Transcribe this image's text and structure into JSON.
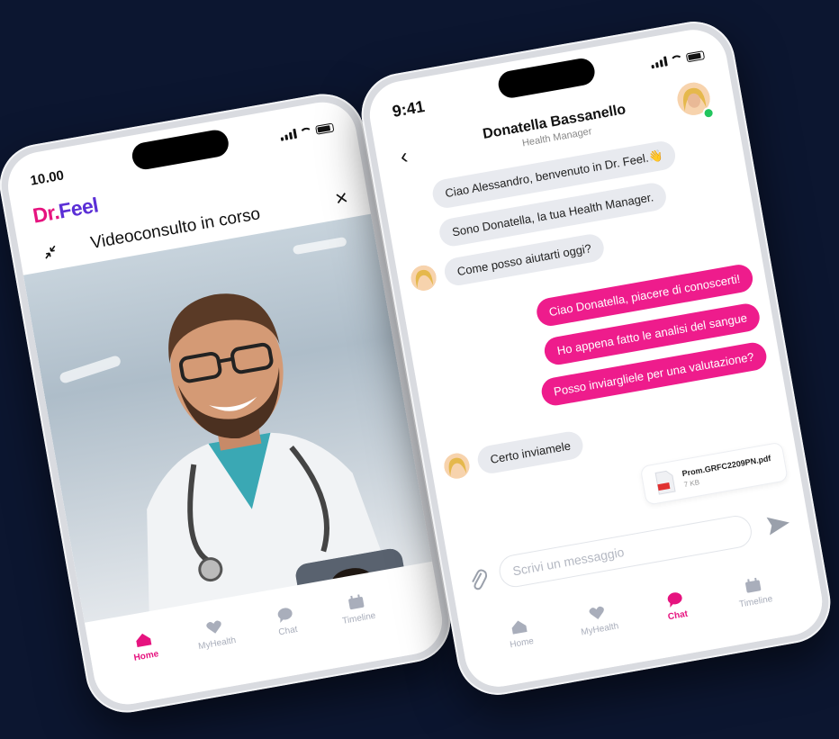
{
  "colors": {
    "background": "#0c1630",
    "brand_pink": "#e6137f",
    "brand_purple": "#5b2fd6",
    "online": "#22c55e"
  },
  "left_phone": {
    "status": {
      "time": "10.00"
    },
    "logo": {
      "part1": "Dr.",
      "part2": "Feel"
    },
    "title": "Videoconsulto in corso",
    "close_icon": "×",
    "tabs": [
      {
        "label": "Home",
        "icon": "home-icon",
        "active": true
      },
      {
        "label": "MyHealth",
        "icon": "heart-icon",
        "active": false
      },
      {
        "label": "Chat",
        "icon": "chat-icon",
        "active": false
      },
      {
        "label": "Timeline",
        "icon": "calendar-icon",
        "active": false
      }
    ]
  },
  "right_phone": {
    "status": {
      "time": "9:41"
    },
    "contact": {
      "name": "Donatella Bassanello",
      "role": "Health Manager",
      "back_icon": "‹"
    },
    "messages": [
      {
        "side": "in",
        "text": "Ciao Alessandro, benvenuto in Dr. Feel.👋"
      },
      {
        "side": "in",
        "text": "Sono Donatella, la tua Health Manager."
      },
      {
        "side": "in",
        "text": "Come posso aiutarti oggi?"
      },
      {
        "side": "out",
        "text": "Ciao Donatella, piacere di conoscerti!"
      },
      {
        "side": "out",
        "text": "Ho appena fatto le analisi del sangue"
      },
      {
        "side": "out",
        "text": "Posso inviargliele per una valutazione?"
      },
      {
        "side": "in",
        "text": "Certo inviamele"
      }
    ],
    "attachment": {
      "name": "Prom.GRFC2209PN.pdf",
      "size": "7 KB"
    },
    "composer": {
      "placeholder": "Scrivi un messaggio"
    },
    "tabs": [
      {
        "label": "Home",
        "icon": "home-icon",
        "active": false
      },
      {
        "label": "MyHealth",
        "icon": "heart-icon",
        "active": false
      },
      {
        "label": "Chat",
        "icon": "chat-icon",
        "active": true
      },
      {
        "label": "Timeline",
        "icon": "calendar-icon",
        "active": false
      }
    ]
  }
}
